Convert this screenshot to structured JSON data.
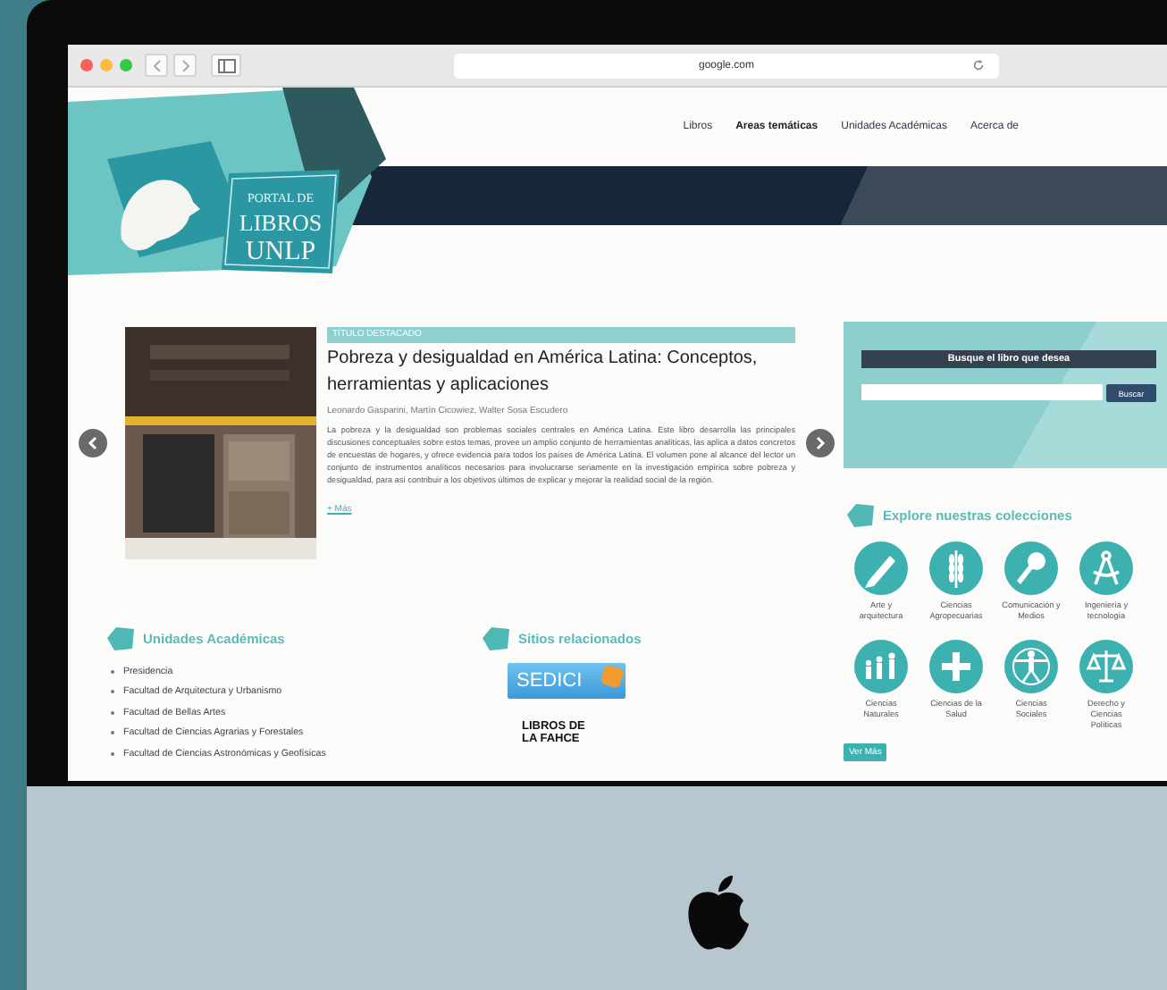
{
  "browser": {
    "url": "google.com"
  },
  "site": {
    "logo_text": [
      "PORTAL DE",
      "LIBROS",
      "UNLP"
    ],
    "nav": [
      {
        "label": "Libros",
        "selected": false
      },
      {
        "label": "Areas temáticas",
        "selected": true
      },
      {
        "label": "Unidades Académicas",
        "selected": false
      },
      {
        "label": "Acerca de",
        "selected": false
      }
    ]
  },
  "featured": {
    "badge": "TÍTULO DESTACADO",
    "title": "Pobreza y desigualdad en América Latina: Conceptos, herramientas y aplicaciones",
    "authors": "Leonardo Gasparini, Martín Cicowiez, Walter Sosa Escudero",
    "description": "La pobreza y la desigualdad son problemas sociales centrales en América Latina. Este libro desarrolla las principales discusiones conceptuales sobre estos temas, provee un amplio conjunto de herramientas analíticas, las aplica a datos concretos de encuestas de hogares, y ofrece evidencia para todos los países de América Latina. El volumen pone al alcance del lector un conjunto de instrumentos analíticos necesarios para involucrarse seriamente en la investigación empírica sobre pobreza y desigualdad, para así contribuir a los objetivos últimos de explicar y mejorar la realidad social de la región.",
    "more_link": "+ Más"
  },
  "search": {
    "heading": "Busque el libro que desea",
    "button": "Buscar"
  },
  "collections": {
    "heading": "Explore nuestras colecciones",
    "items": [
      {
        "label": "Arte y arquitectura"
      },
      {
        "label": "Ciencias Agropecuarias"
      },
      {
        "label": "Comunicación y Medios"
      },
      {
        "label": "Ingeniería y tecnología"
      },
      {
        "label": "Ciencias Naturales"
      },
      {
        "label": "Ciencias de la Salud"
      },
      {
        "label": "Ciencias Sociales"
      },
      {
        "label": "Derecho y Ciencias Políticas"
      }
    ],
    "more_button": "Ver Más"
  },
  "units": {
    "heading": "Unidades Académicas",
    "items": [
      "Presidencia",
      "Facultad de Arquitectura y Urbanismo",
      "Facultad de Bellas Artes",
      "Facultad de Ciencias Agrarias y Forestales",
      "Facultad de Ciencias Astronómicas y Geofísicas"
    ]
  },
  "related": {
    "heading": "Sitios relacionados",
    "sites": [
      "SEDICI",
      "LIBROS DE LA FAHCE"
    ]
  }
}
